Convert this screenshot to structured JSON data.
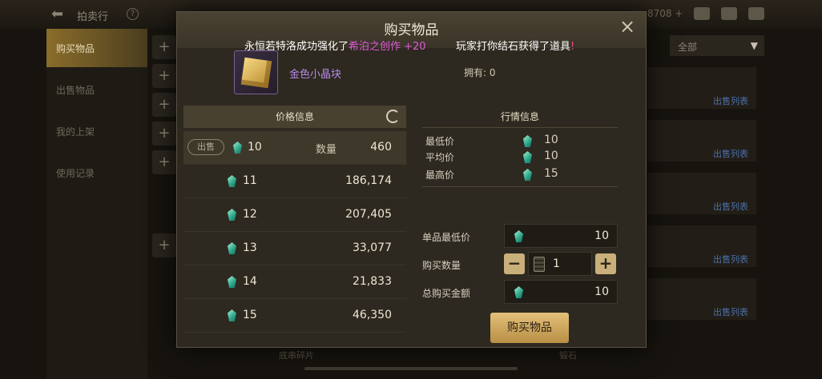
{
  "background": {
    "header": {
      "back_glyph": "⬅",
      "title": "拍卖行",
      "currency": "8708 +"
    },
    "sidebar": {
      "items": [
        {
          "label": "购买物品",
          "active": true
        },
        {
          "label": "出售物品",
          "active": false
        },
        {
          "label": "我的上架",
          "active": false
        },
        {
          "label": "使用记录",
          "active": false
        }
      ]
    },
    "filter_dropdown": {
      "value": "全部"
    },
    "list_link": "出售列表",
    "bottom_items": [
      "底串碎片",
      "锻石"
    ]
  },
  "modal": {
    "title": "购买物品",
    "close_glyph": "×",
    "ticker": {
      "message1_prefix": "永恒若特洛成功强化了",
      "message1_item": "希泊之创作 +20",
      "message2_prefix": "玩家打你结石获得了道具",
      "message2_suffix": "!"
    },
    "item": {
      "name": "金色小晶块",
      "owned_label": "拥有:",
      "owned_value": "0"
    },
    "price_info": {
      "header": "价格信息",
      "sell_tag": "出售",
      "qty_label": "数量",
      "rows": [
        {
          "price": "10",
          "qty": "460"
        },
        {
          "price": "11",
          "qty": "186,174"
        },
        {
          "price": "12",
          "qty": "207,405"
        },
        {
          "price": "13",
          "qty": "33,077"
        },
        {
          "price": "14",
          "qty": "21,833"
        },
        {
          "price": "15",
          "qty": "46,350"
        }
      ]
    },
    "market_info": {
      "header": "行情信息",
      "lowest_label": "最低价",
      "lowest_value": "10",
      "average_label": "平均价",
      "average_value": "10",
      "highest_label": "最高价",
      "highest_value": "15"
    },
    "purchase": {
      "unit_min_label": "单品最低价",
      "unit_min_value": "10",
      "quantity_label": "购买数量",
      "quantity_value": "1",
      "minus_glyph": "−",
      "plus_glyph": "+",
      "total_label": "总购买金额",
      "total_value": "10",
      "buy_button": "购买物品"
    }
  }
}
